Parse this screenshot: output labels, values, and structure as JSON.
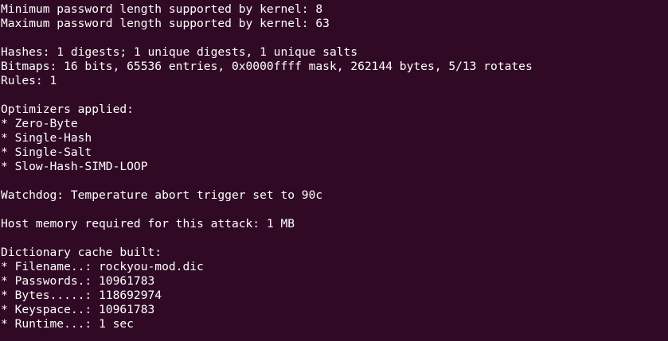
{
  "terminal": {
    "background_color": "#300a24",
    "text_color": "#ffffff",
    "lines": [
      "Minimum password length supported by kernel: 8",
      "Maximum password length supported by kernel: 63",
      "",
      "Hashes: 1 digests; 1 unique digests, 1 unique salts",
      "Bitmaps: 16 bits, 65536 entries, 0x0000ffff mask, 262144 bytes, 5/13 rotates",
      "Rules: 1",
      "",
      "Optimizers applied:",
      "* Zero-Byte",
      "* Single-Hash",
      "* Single-Salt",
      "* Slow-Hash-SIMD-LOOP",
      "",
      "Watchdog: Temperature abort trigger set to 90c",
      "",
      "Host memory required for this attack: 1 MB",
      "",
      "Dictionary cache built:",
      "* Filename..: rockyou-mod.dic",
      "* Passwords.: 10961783",
      "* Bytes.....: 118692974",
      "* Keyspace..: 10961783",
      "* Runtime...: 1 sec"
    ]
  }
}
